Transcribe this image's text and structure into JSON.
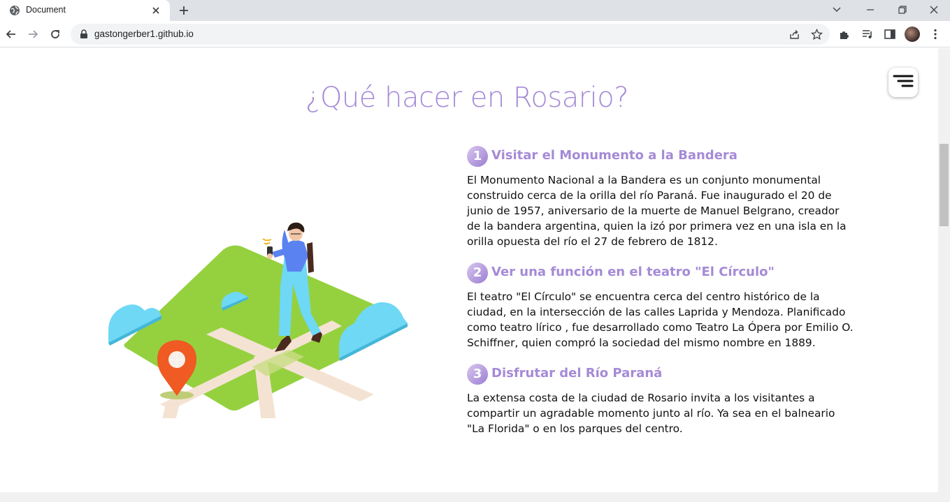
{
  "browser": {
    "tab_title": "Document",
    "url": "gastongerber1.github.io"
  },
  "page": {
    "title": "¿Qué hacer en Rosario?",
    "items": [
      {
        "number": "1",
        "title": "Visitar el Monumento a la Bandera",
        "body": "El Monumento Nacional a la Bandera es un conjunto monumental construido cerca de la orilla del río Paraná. Fue inaugurado el 20 de junio de 1957, aniversario de la muerte de Manuel Belgrano, creador de la bandera argentina, quien la izó por primera vez en una isla en la orilla opuesta del río el 27 de febrero de 1812."
      },
      {
        "number": "2",
        "title": "Ver una función en el teatro \"El Círculo\"",
        "body": "El teatro \"El Círculo\" se encuentra cerca del centro histórico de la ciudad, en la intersección de las calles Laprida y Mendoza. Planificado como teatro lírico , fue desarrollado como Teatro La Ópera por Emilio O. Schiffner, quien compró la sociedad del mismo nombre en 1889."
      },
      {
        "number": "3",
        "title": "Disfrutar del Río Paraná",
        "body": "La extensa costa de la ciudad de Rosario invita a los visitantes a compartir un agradable momento junto al río. Ya sea en el balneario \"La Florida\" o en los parques del centro."
      }
    ]
  },
  "colors": {
    "accent": "#a58ad6",
    "grass": "#95d13f",
    "path": "#f4e3d3",
    "cloud": "#6ed8f5",
    "pin": "#f05a23"
  },
  "icons": [
    "globe-icon",
    "close-icon",
    "plus-icon",
    "chevron-down-icon",
    "minimize-icon",
    "restore-icon",
    "close-window-icon",
    "back-icon",
    "forward-icon",
    "reload-icon",
    "lock-icon",
    "share-icon",
    "star-icon",
    "extensions-icon",
    "media-icon",
    "side-panel-icon",
    "kebab-menu-icon",
    "hamburger-menu-icon"
  ]
}
